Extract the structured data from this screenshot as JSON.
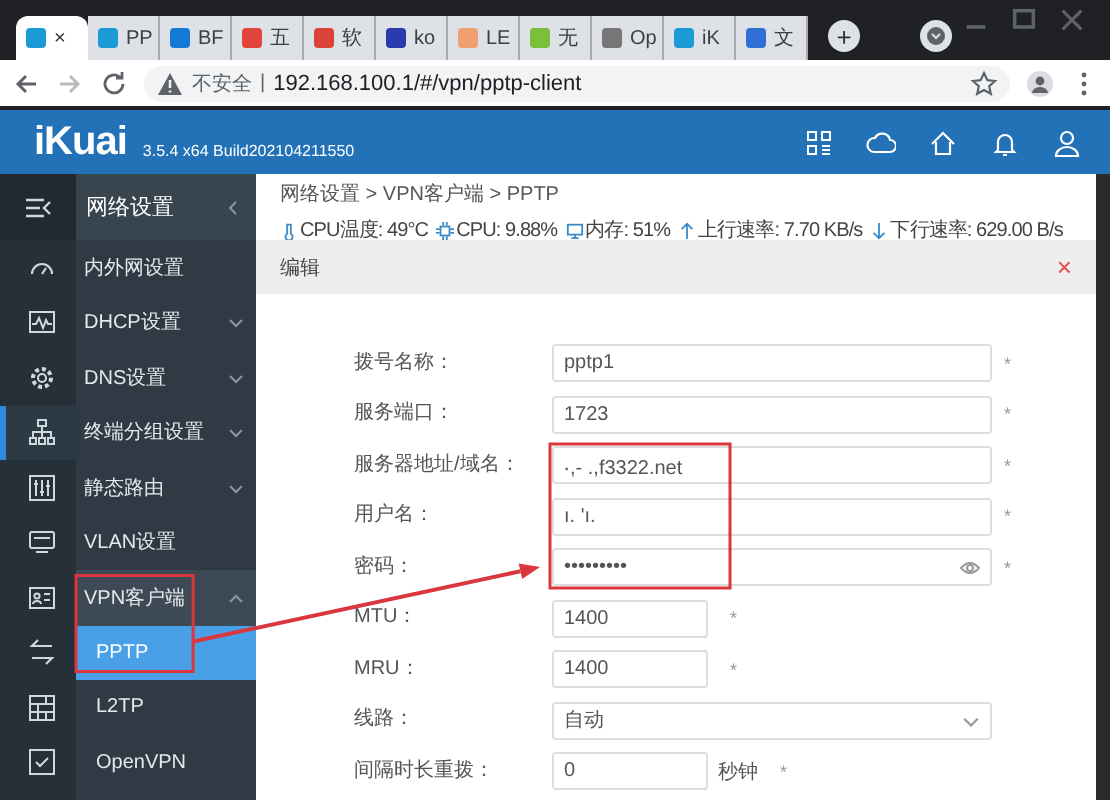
{
  "browser": {
    "tabs": [
      {
        "selected": true,
        "color": "#1b9ad6",
        "close": "×"
      },
      {
        "label": "PP",
        "selected": false,
        "color": "#1b9ad6"
      },
      {
        "label": "BF",
        "selected": false,
        "color": "#1479d4"
      },
      {
        "label": "五",
        "selected": false,
        "color": "#e0443c"
      },
      {
        "label": "软",
        "selected": false,
        "color": "#d9433a"
      },
      {
        "label": "ko",
        "selected": false,
        "color": "#2a3bb0"
      },
      {
        "label": "LE",
        "selected": false,
        "color": "#f0a070"
      },
      {
        "label": "无",
        "selected": false,
        "color": "#7cbf3a"
      },
      {
        "label": "Op",
        "selected": false,
        "color": "#777777"
      },
      {
        "label": "iK",
        "selected": false,
        "color": "#1b9ad6"
      },
      {
        "label": "文",
        "selected": false,
        "color": "#2f6fd6"
      }
    ],
    "new_tab": "+",
    "address": {
      "security": "不安全",
      "separator": "|",
      "url": "192.168.100.1/#/vpn/pptp-client"
    }
  },
  "header": {
    "logo": "iKuai",
    "version": "3.5.4 x64 Build202104211550"
  },
  "rail": {
    "items": [
      {
        "kind": "gauge",
        "selected": false
      },
      {
        "kind": "pulse",
        "selected": false
      },
      {
        "kind": "gear",
        "selected": false
      },
      {
        "kind": "network",
        "selected": true
      },
      {
        "kind": "sliders",
        "selected": false
      },
      {
        "kind": "screen",
        "selected": false
      },
      {
        "kind": "card",
        "selected": false
      },
      {
        "kind": "swap",
        "selected": false
      },
      {
        "kind": "grid",
        "selected": false
      },
      {
        "kind": "checklist",
        "selected": false
      }
    ]
  },
  "sidebar": {
    "title": "网络设置",
    "items": [
      {
        "label": "内外网设置",
        "expandable": false,
        "selected": false,
        "marked": false
      },
      {
        "label": "DHCP设置",
        "expandable": true,
        "expanded": false,
        "selected": false,
        "marked": false
      },
      {
        "label": "DNS设置",
        "expandable": true,
        "expanded": false,
        "selected": false,
        "marked": false
      },
      {
        "label": "终端分组设置",
        "expandable": true,
        "expanded": false,
        "selected": false,
        "marked": false
      },
      {
        "label": "静态路由",
        "expandable": true,
        "expanded": false,
        "selected": false,
        "marked": false
      },
      {
        "label": "VLAN设置",
        "expandable": false,
        "selected": false,
        "marked": false
      },
      {
        "label": "VPN客户端",
        "expandable": true,
        "expanded": true,
        "selected": false,
        "marked": true,
        "children": [
          {
            "label": "PPTP",
            "selected": true,
            "marked": true
          },
          {
            "label": "L2TP",
            "selected": false,
            "marked": false
          },
          {
            "label": "OpenVPN",
            "selected": false,
            "marked": false
          }
        ]
      }
    ]
  },
  "breadcrumb": "网络设置 > VPN客户端 > PPTP",
  "stats": [
    {
      "kind": "temp",
      "text": "CPU温度: 49°C"
    },
    {
      "kind": "cpu",
      "text": "CPU: 9.88%"
    },
    {
      "kind": "memory",
      "text": "内存: 51%"
    },
    {
      "kind": "up",
      "text": "上行速率: 7.70 KB/s"
    },
    {
      "kind": "down",
      "text": "下行速率: 629.00 B/s"
    }
  ],
  "dialog": {
    "title": "编辑",
    "close": "×",
    "fields": [
      {
        "kind": "text",
        "label": "拨号名称：",
        "value": "pptp1",
        "asterisk": "*",
        "marked": false
      },
      {
        "kind": "text",
        "label": "服务端口：",
        "value": "1723",
        "asterisk": "*",
        "marked": false
      },
      {
        "kind": "text",
        "label": "服务器地址/域名：",
        "value": "‧,-  .,f3322.net",
        "asterisk": "*",
        "marked": true
      },
      {
        "kind": "text",
        "label": "用户名：",
        "value": "ı. 'ı.",
        "asterisk": "*",
        "marked": true
      },
      {
        "kind": "password",
        "label": "密码：",
        "value": "•••••••••",
        "asterisk": "*",
        "marked": true
      },
      {
        "kind": "short",
        "label": "MTU：",
        "value": "1400",
        "asterisk": "*",
        "marked": false
      },
      {
        "kind": "short",
        "label": "MRU：",
        "value": "1400",
        "asterisk": "*",
        "marked": false
      },
      {
        "kind": "select",
        "label": "线路：",
        "value": "自动",
        "marked": false
      },
      {
        "kind": "short",
        "label": "间隔时长重拨：",
        "value": "0",
        "unit": "秒钟",
        "asterisk": "*",
        "marked": false
      }
    ]
  },
  "annotation": {
    "color": "#d9363e"
  }
}
